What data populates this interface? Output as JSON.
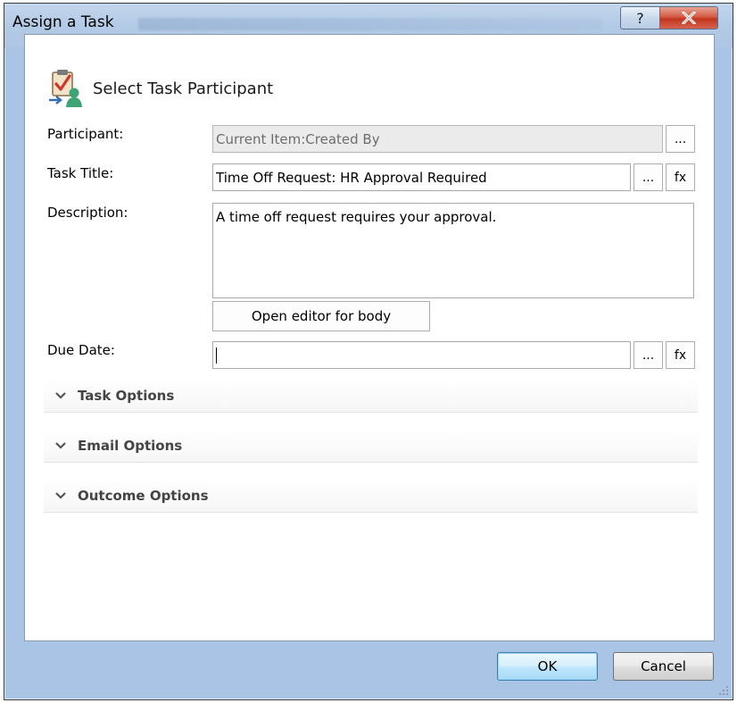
{
  "window": {
    "title": "Assign a Task",
    "help_glyph": "?",
    "close_icon": "close-x-icon"
  },
  "header": {
    "title": "Select Task Participant",
    "icon": "task-participant-icon"
  },
  "form": {
    "participant": {
      "label": "Participant:",
      "value": "Current Item:Created By",
      "browse_label": "..."
    },
    "task_title": {
      "label": "Task Title:",
      "value": "Time Off Request: HR Approval Required",
      "browse_label": "...",
      "fx_label": "fx"
    },
    "description": {
      "label": "Description:",
      "value": "A time off request requires your approval.",
      "editor_button_label": "Open editor for body"
    },
    "due_date": {
      "label": "Due Date:",
      "value": "",
      "browse_label": "...",
      "fx_label": "fx"
    }
  },
  "sections": [
    {
      "label": "Task Options"
    },
    {
      "label": "Email Options"
    },
    {
      "label": "Outcome Options"
    }
  ],
  "footer": {
    "ok_label": "OK",
    "cancel_label": "Cancel"
  },
  "colors": {
    "frame": "#a9c4e4",
    "close": "#c2361f",
    "ok_highlight": "#bee6fd"
  }
}
